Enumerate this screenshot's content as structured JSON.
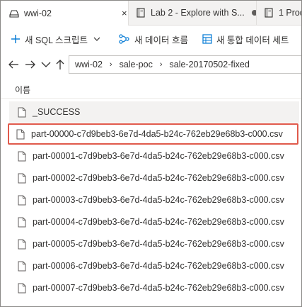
{
  "tabs": [
    {
      "label": "wwi-02",
      "close": "×",
      "icon": "database-icon",
      "active": true
    },
    {
      "label": "Lab 2 - Explore with S...",
      "icon": "notebook-icon",
      "modified": true
    },
    {
      "label": "1 Prod",
      "icon": "notebook-icon"
    }
  ],
  "toolbar": {
    "new_sql_script": "새 SQL 스크립트",
    "new_dataflow": "새 데이터 흐름",
    "new_integration_dataset": "새 통합 데이터 세트"
  },
  "breadcrumb": [
    "wwi-02",
    "sale-poc",
    "sale-20170502-fixed"
  ],
  "list": {
    "column_header": "이름",
    "items": [
      "_SUCCESS",
      "part-00000-c7d9beb3-6e7d-4da5-b24c-762eb29e68b3-c000.csv",
      "part-00001-c7d9beb3-6e7d-4da5-b24c-762eb29e68b3-c000.csv",
      "part-00002-c7d9beb3-6e7d-4da5-b24c-762eb29e68b3-c000.csv",
      "part-00003-c7d9beb3-6e7d-4da5-b24c-762eb29e68b3-c000.csv",
      "part-00004-c7d9beb3-6e7d-4da5-b24c-762eb29e68b3-c000.csv",
      "part-00005-c7d9beb3-6e7d-4da5-b24c-762eb29e68b3-c000.csv",
      "part-00006-c7d9beb3-6e7d-4da5-b24c-762eb29e68b3-c000.csv",
      "part-00007-c7d9beb3-6e7d-4da5-b24c-762eb29e68b3-c000.csv"
    ],
    "highlighted_index": 1
  },
  "colors": {
    "accent": "#0078d4",
    "highlight_border": "#e05a4c"
  }
}
